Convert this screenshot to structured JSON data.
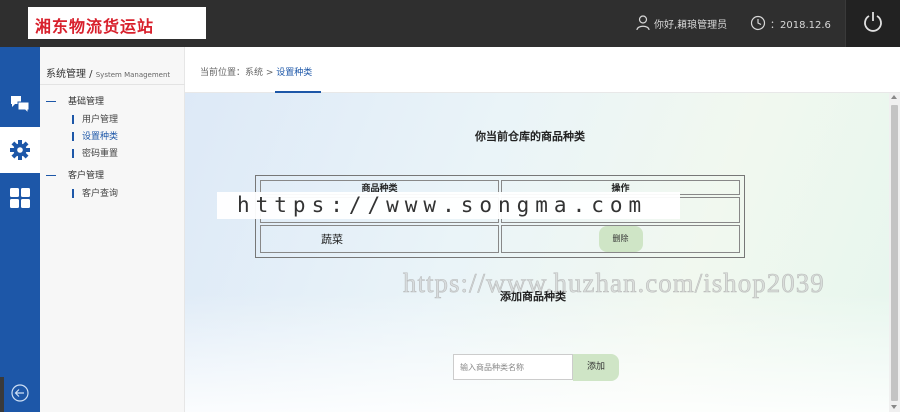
{
  "header": {
    "logo_text": "湘东物流货运站",
    "greeting": "你好,頛琅管理员",
    "date": "：2018.12.6"
  },
  "colors": {
    "header_bg": "#2f2f2f",
    "rail_bg": "#1d57a8",
    "logo_red": "#d8202c",
    "button_green": "#cfe5c6"
  },
  "rail": {
    "icons": [
      "chat-bubbles-icon",
      "gear-icon",
      "grid-icon",
      "back-arrow-icon"
    ],
    "active_index": 1
  },
  "submenu": {
    "title": "系统管理",
    "title_sep": " / ",
    "title_en": "System Management",
    "groups": [
      {
        "label": "基础管理",
        "items": [
          "用户管理",
          "设置种类",
          "密码重置"
        ]
      },
      {
        "label": "客户管理",
        "items": [
          "客户查询"
        ]
      }
    ],
    "active_item": "设置种类"
  },
  "breadcrumb": {
    "prefix": "当前位置：系统 > ",
    "current": "设置种类"
  },
  "main": {
    "section_title": "你当前仓库的商品种类",
    "table": {
      "headers": [
        "商品种类",
        "操作"
      ],
      "rows": [
        {
          "category": "",
          "action": ""
        },
        {
          "category": "蔬菜",
          "action": "删除"
        }
      ]
    },
    "add_title": "添加商品种类",
    "add_placeholder": "输入商品种类名称",
    "add_button": "添加"
  },
  "watermarks": {
    "wm1": "https://www.songma.com",
    "wm2": "https://www.huzhan.com/ishop2039"
  }
}
